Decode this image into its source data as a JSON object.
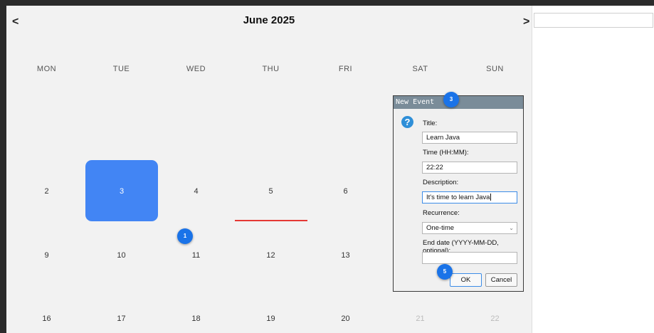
{
  "header": {
    "month_title": "June 2025",
    "prev": "<",
    "next": ">"
  },
  "weekdays": [
    "MON",
    "TUE",
    "WED",
    "THU",
    "FRI",
    "SAT",
    "SUN"
  ],
  "weeks": [
    [
      "2",
      "3",
      "4",
      "5",
      "6",
      "",
      ""
    ],
    [
      "9",
      "10",
      "11",
      "12",
      "13",
      "",
      ""
    ],
    [
      "16",
      "17",
      "18",
      "19",
      "20",
      "21",
      "22"
    ]
  ],
  "selected_day": "3",
  "dialog": {
    "title": "New Event",
    "icon": "question-icon",
    "title_label": "Title:",
    "title_value": "Learn Java",
    "time_label": "Time (HH:MM):",
    "time_value": "22:22",
    "description_label": "Description:",
    "description_value": "It's time to learn Java",
    "recurrence_label": "Recurrence:",
    "recurrence_value": "One-time",
    "end_date_label": "End date (YYYY-MM-DD, optional):",
    "end_date_value": "",
    "ok_label": "OK",
    "cancel_label": "Cancel"
  },
  "badges": {
    "b1": "1",
    "b3": "3",
    "b5": "5"
  },
  "colors": {
    "selected": "#4285f4",
    "today_line": "#e53935",
    "badge": "#1a73e8"
  }
}
